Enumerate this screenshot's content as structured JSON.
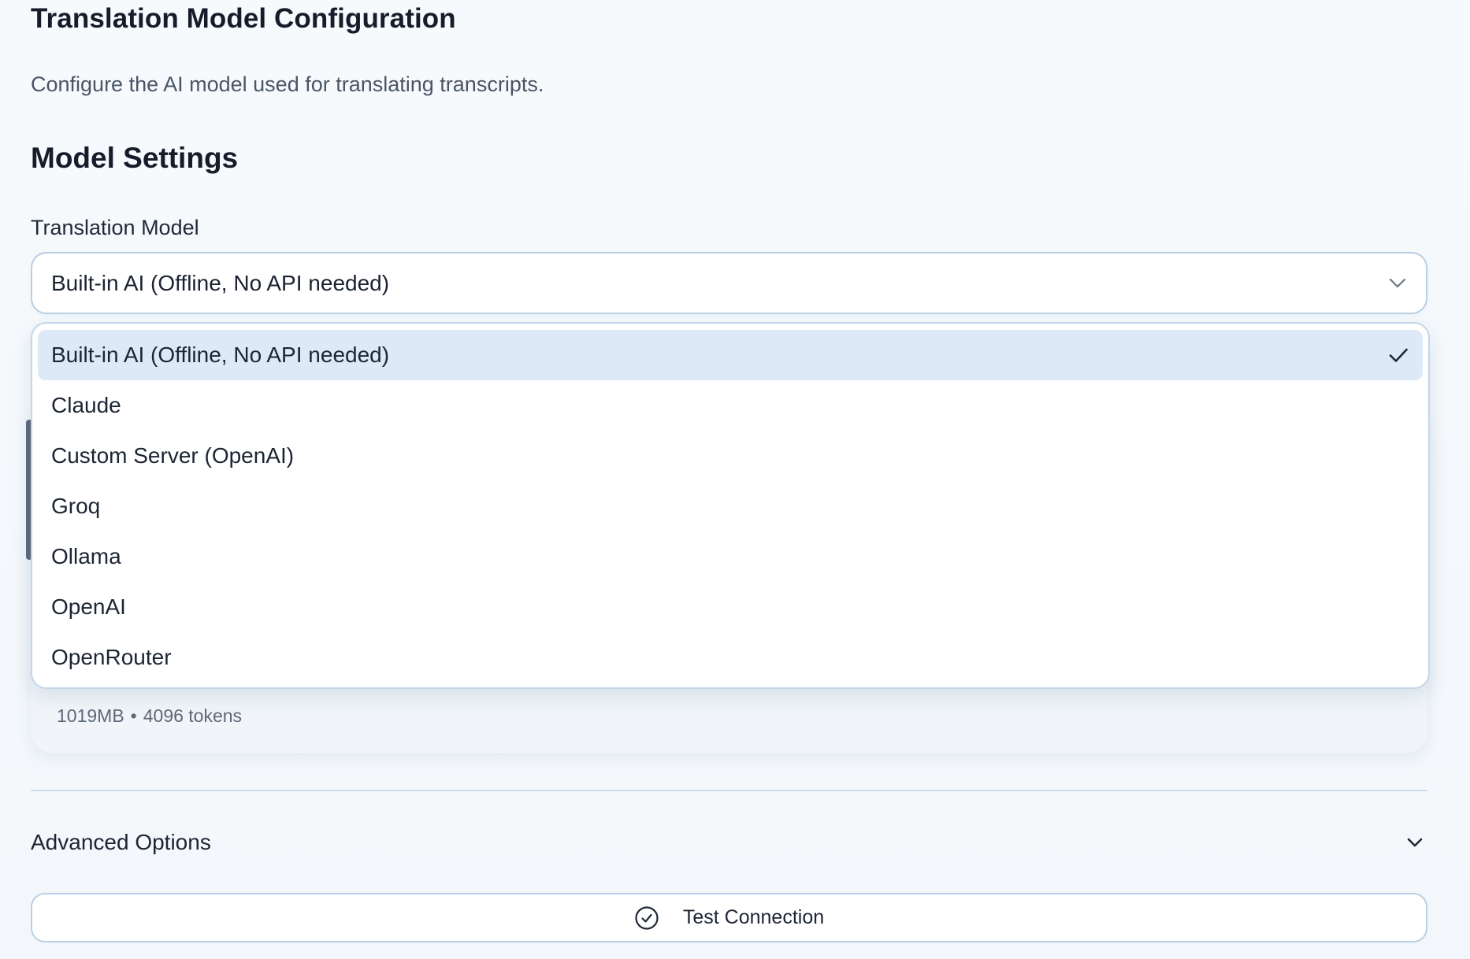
{
  "header": {
    "title": "Translation Model Configuration",
    "subtitle": "Configure the AI model used for translating transcripts."
  },
  "model_settings": {
    "section_title": "Model Settings",
    "field_label": "Translation Model",
    "selected_value": "Built-in AI (Offline, No API needed)",
    "dropdown_open": true,
    "options": [
      {
        "label": "Built-in AI (Offline, No API needed)",
        "selected": true
      },
      {
        "label": "Claude",
        "selected": false
      },
      {
        "label": "Custom Server (OpenAI)",
        "selected": false
      },
      {
        "label": "Groq",
        "selected": false
      },
      {
        "label": "Ollama",
        "selected": false
      },
      {
        "label": "OpenAI",
        "selected": false
      },
      {
        "label": "OpenRouter",
        "selected": false
      }
    ]
  },
  "model_card": {
    "size": "1019MB",
    "separator": "•",
    "context": "4096 tokens"
  },
  "advanced": {
    "label": "Advanced Options",
    "icon": "chevron-down-icon"
  },
  "actions": {
    "test_connection_label": "Test Connection",
    "test_connection_icon": "check-circle-icon"
  },
  "colors": {
    "accent_border": "#b9cfe3",
    "selected_option_bg": "#dde9f6",
    "text_primary": "#1c2533",
    "text_muted": "#4a5566"
  }
}
